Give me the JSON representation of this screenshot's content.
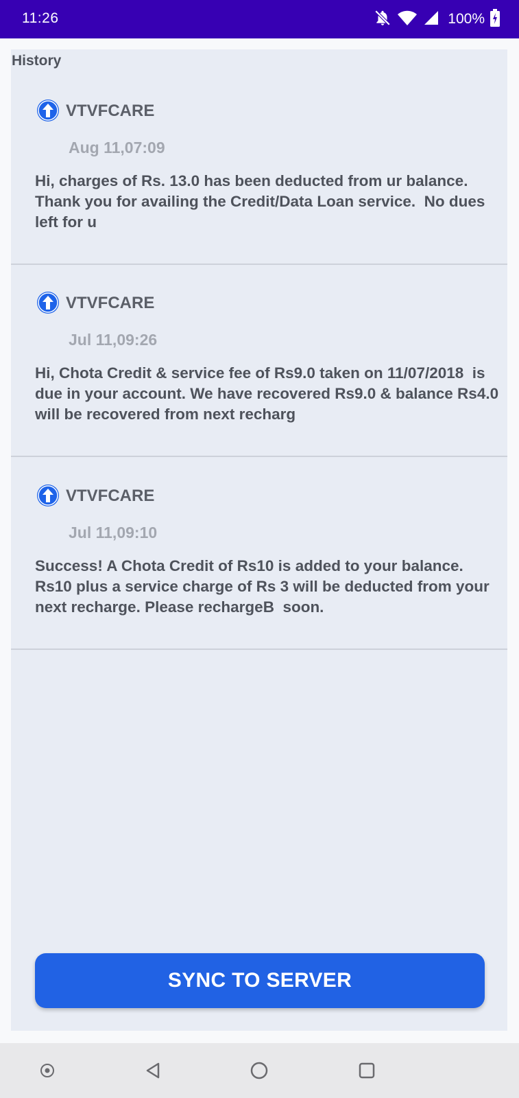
{
  "status_bar": {
    "time": "11:26",
    "battery": "100%",
    "icons": [
      "notifications-off-icon",
      "wifi-icon",
      "signal-icon",
      "battery-charging-icon"
    ]
  },
  "header": {
    "title": "History"
  },
  "messages": [
    {
      "sender": "VTVFCARE",
      "date": "Aug 11,07:09",
      "body": "Hi, charges of Rs. 13.0 has been deducted from ur balance. Thank you for availing the Credit/Data Loan service.  No dues left for u",
      "icon": "arrow-up-circle-icon"
    },
    {
      "sender": "VTVFCARE",
      "date": "Jul 11,09:26",
      "body": "Hi, Chota Credit & service fee of Rs9.0 taken on 11/07/2018  is due in your account. We have recovered Rs9.0 & balance Rs4.0 will be recovered from next recharg",
      "icon": "arrow-up-circle-icon"
    },
    {
      "sender": "VTVFCARE",
      "date": "Jul 11,09:10",
      "body": "Success! A Chota Credit of Rs10 is added to your balance. Rs10 plus a service charge of Rs 3 will be deducted from your next recharge. Please rechargeB  soon.",
      "icon": "arrow-up-circle-icon"
    }
  ],
  "sync_button": {
    "label": "SYNC TO SERVER"
  },
  "nav_bar": {
    "icons": [
      "assistant-icon",
      "back-icon",
      "home-icon",
      "recents-icon"
    ]
  },
  "colors": {
    "status_bar": "#3700b3",
    "accent": "#2162e4",
    "panel": "#e8ecf4"
  }
}
